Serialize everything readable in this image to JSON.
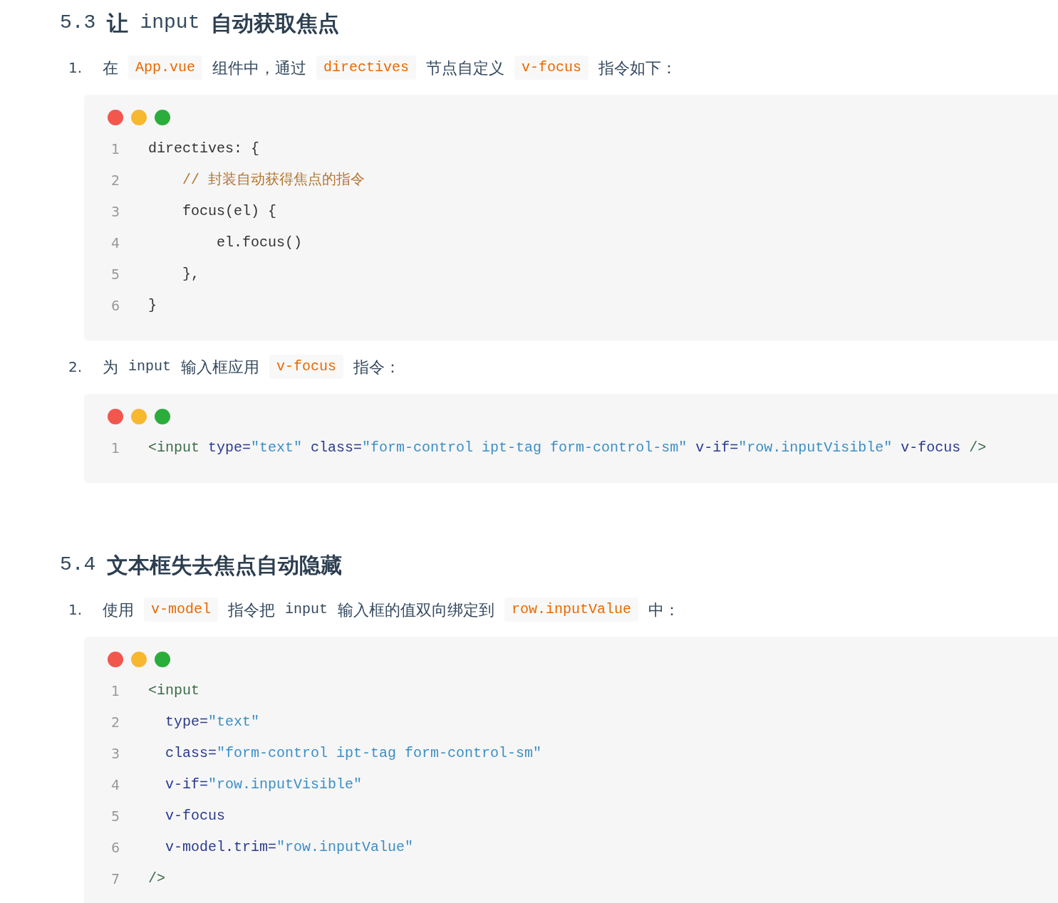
{
  "sections": [
    {
      "heading": [
        {
          "kind": "code",
          "text": "5.3"
        },
        {
          "kind": "text",
          "text": "让"
        },
        {
          "kind": "code",
          "text": "input"
        },
        {
          "kind": "text",
          "text": "自动获取焦点"
        }
      ],
      "steps": [
        {
          "number": "1.",
          "paragraph": [
            {
              "kind": "text",
              "text": "在"
            },
            {
              "kind": "code",
              "text": "App.vue"
            },
            {
              "kind": "text",
              "text": "组件中，通过"
            },
            {
              "kind": "code",
              "text": "directives"
            },
            {
              "kind": "text",
              "text": "节点自定义"
            },
            {
              "kind": "code",
              "text": "v-focus"
            },
            {
              "kind": "text",
              "text": "指令如下："
            }
          ],
          "code": [
            {
              "number": "1",
              "tokens": [
                {
                  "kind": "plain",
                  "text": "directives: {"
                }
              ]
            },
            {
              "number": "2",
              "tokens": [
                {
                  "kind": "comment",
                  "text": "    // 封装自动获得焦点的指令"
                }
              ]
            },
            {
              "number": "3",
              "tokens": [
                {
                  "kind": "plain",
                  "text": "    focus(el) {"
                }
              ]
            },
            {
              "number": "4",
              "tokens": [
                {
                  "kind": "plain",
                  "text": "        el.focus()"
                }
              ]
            },
            {
              "number": "5",
              "tokens": [
                {
                  "kind": "plain",
                  "text": "    },"
                }
              ]
            },
            {
              "number": "6",
              "tokens": [
                {
                  "kind": "plain",
                  "text": "}"
                }
              ]
            }
          ]
        },
        {
          "number": "2.",
          "paragraph": [
            {
              "kind": "text",
              "text": "为"
            },
            {
              "kind": "plain_code",
              "text": "input"
            },
            {
              "kind": "text",
              "text": "输入框应用"
            },
            {
              "kind": "code",
              "text": "v-focus"
            },
            {
              "kind": "text",
              "text": "指令："
            }
          ],
          "code": [
            {
              "number": "1",
              "tokens": [
                {
                  "kind": "tag",
                  "text": "<input"
                },
                {
                  "kind": "attr",
                  "text": " type="
                },
                {
                  "kind": "string",
                  "text": "\"text\""
                },
                {
                  "kind": "attr",
                  "text": " class="
                },
                {
                  "kind": "string",
                  "text": "\"form-control ipt-tag form-control-sm\""
                },
                {
                  "kind": "attr",
                  "text": " v-if="
                },
                {
                  "kind": "string",
                  "text": "\"row.inputVisible\""
                },
                {
                  "kind": "attr",
                  "text": " v-focus"
                },
                {
                  "kind": "tag",
                  "text": " />"
                }
              ]
            }
          ]
        }
      ]
    },
    {
      "heading": [
        {
          "kind": "code",
          "text": "5.4"
        },
        {
          "kind": "text",
          "text": "文本框失去焦点自动隐藏"
        }
      ],
      "steps": [
        {
          "number": "1.",
          "paragraph": [
            {
              "kind": "text",
              "text": "使用"
            },
            {
              "kind": "code",
              "text": "v-model"
            },
            {
              "kind": "text",
              "text": "指令把"
            },
            {
              "kind": "plain_code",
              "text": "input"
            },
            {
              "kind": "text",
              "text": "输入框的值双向绑定到"
            },
            {
              "kind": "code",
              "text": "row.inputValue"
            },
            {
              "kind": "text",
              "text": "中："
            }
          ],
          "code": [
            {
              "number": "1",
              "tokens": [
                {
                  "kind": "tag",
                  "text": "<input"
                }
              ]
            },
            {
              "number": "2",
              "tokens": [
                {
                  "kind": "attr",
                  "text": "  type="
                },
                {
                  "kind": "string",
                  "text": "\"text\""
                }
              ]
            },
            {
              "number": "3",
              "tokens": [
                {
                  "kind": "attr",
                  "text": "  class="
                },
                {
                  "kind": "string",
                  "text": "\"form-control ipt-tag form-control-sm\""
                }
              ]
            },
            {
              "number": "4",
              "tokens": [
                {
                  "kind": "attr",
                  "text": "  v-if="
                },
                {
                  "kind": "string",
                  "text": "\"row.inputVisible\""
                }
              ]
            },
            {
              "number": "5",
              "tokens": [
                {
                  "kind": "attr",
                  "text": "  v-focus"
                }
              ]
            },
            {
              "number": "6",
              "tokens": [
                {
                  "kind": "attr",
                  "text": "  v-model.trim="
                },
                {
                  "kind": "string",
                  "text": "\"row.inputValue\""
                }
              ]
            },
            {
              "number": "7",
              "tokens": [
                {
                  "kind": "tag",
                  "text": "/>"
                }
              ]
            }
          ]
        }
      ]
    }
  ]
}
